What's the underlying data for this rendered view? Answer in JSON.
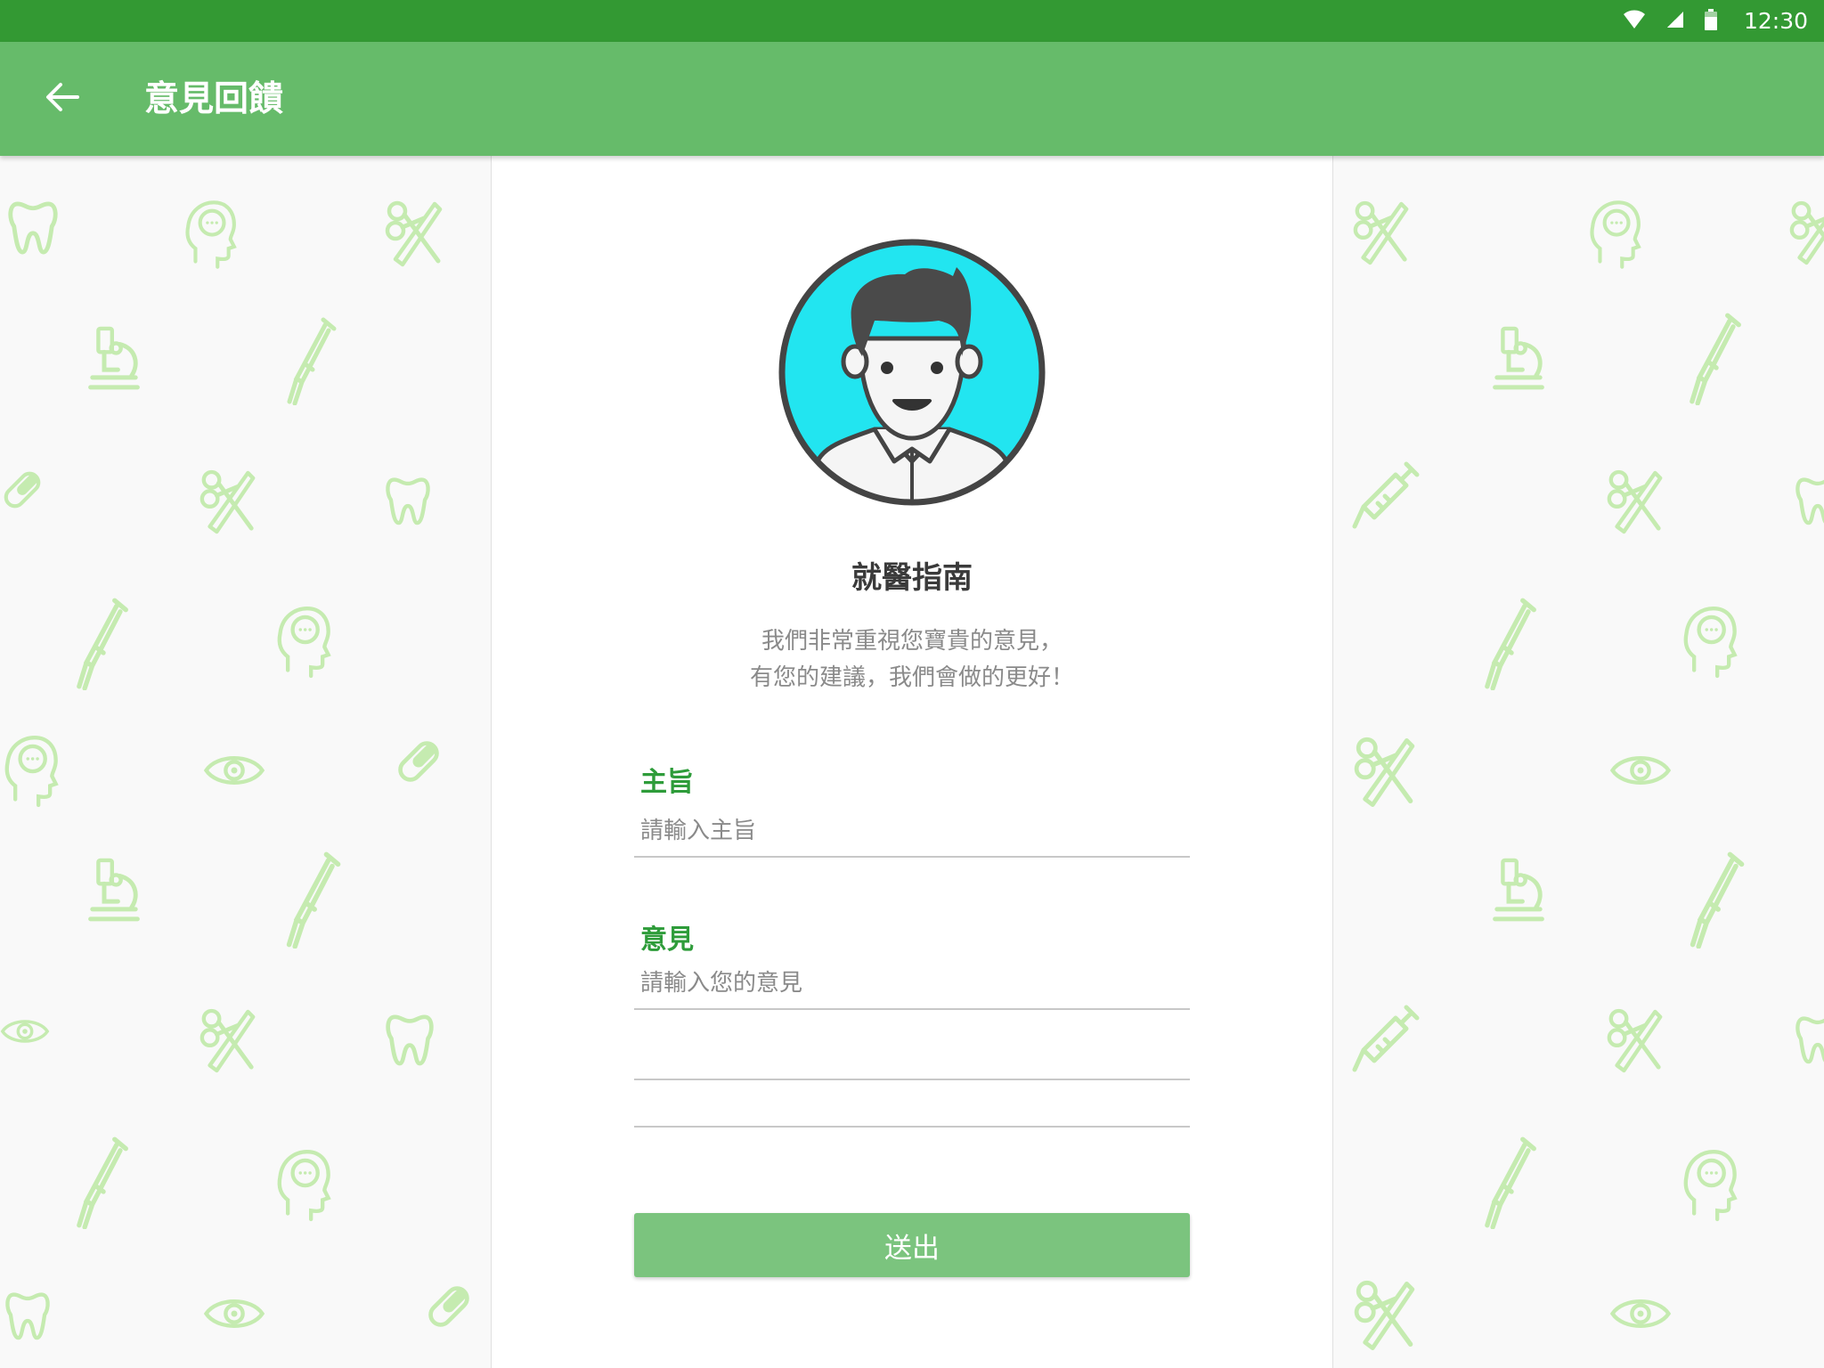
{
  "status_bar": {
    "time": "12:30",
    "icons": [
      "wifi-icon",
      "signal-icon",
      "battery-icon"
    ]
  },
  "app_bar": {
    "title": "意見回饋",
    "back_icon": "arrow-back-icon"
  },
  "card": {
    "avatar_icon": "doctor-avatar-icon",
    "brand_title": "就醫指南",
    "intro_line1": "我們非常重視您寶貴的意見，",
    "intro_line2": "有您的建議，我們會做的更好！"
  },
  "form": {
    "subject_label": "主旨",
    "subject_placeholder": "請輸入主旨",
    "subject_value": "",
    "feedback_label": "意見",
    "feedback_placeholder": "請輸入您的意見",
    "feedback_value": "",
    "submit_label": "送出"
  },
  "background_icons": [
    "tooth-icon",
    "head-brain-icon",
    "scissors-scalpel-icon",
    "microscope-icon",
    "crutch-icon",
    "pill-icon",
    "eye-icon",
    "syringe-icon"
  ],
  "colors": {
    "status_bar": "#339933",
    "app_bar": "#66bb6a",
    "accent_label": "#2e9c3a",
    "submit_button": "#7bc47e",
    "pattern_icon": "#c5ebb0",
    "avatar_bg": "#22e5f0"
  }
}
